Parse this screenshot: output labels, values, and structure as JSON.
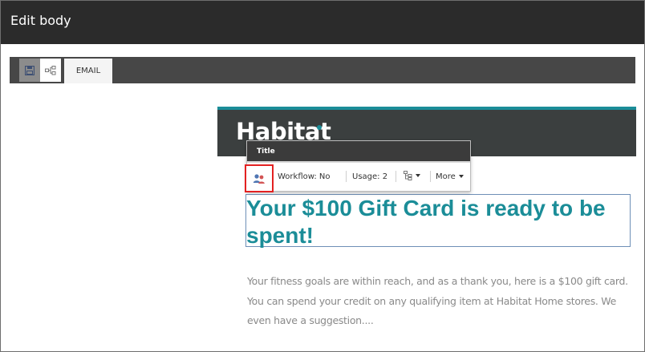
{
  "dialog": {
    "title": "Edit body"
  },
  "toolbar": {
    "save_icon": "save-icon",
    "tree_icon": "tree-structure-icon",
    "tab_label": "EMAIL"
  },
  "email": {
    "logo_text": "Habitat",
    "heading": "Your $100 Gift Card is ready to be spent!",
    "body": "Your fitness goals are within reach, and as a thank you, here is a $100 gift card. You can spend your credit on any qualifying item at Habitat Home stores. We even have a suggestion...."
  },
  "chrome": {
    "title": "Title",
    "personalize_icon": "users-icon",
    "workflow": "Workflow: No",
    "usage": "Usage: 2",
    "datasource_icon": "datasource-tree-icon",
    "more": "More"
  },
  "colors": {
    "accent": "#1b8d98",
    "highlight": "#e32121",
    "titlebar": "#2b2b2b",
    "toolbar": "#474747"
  }
}
